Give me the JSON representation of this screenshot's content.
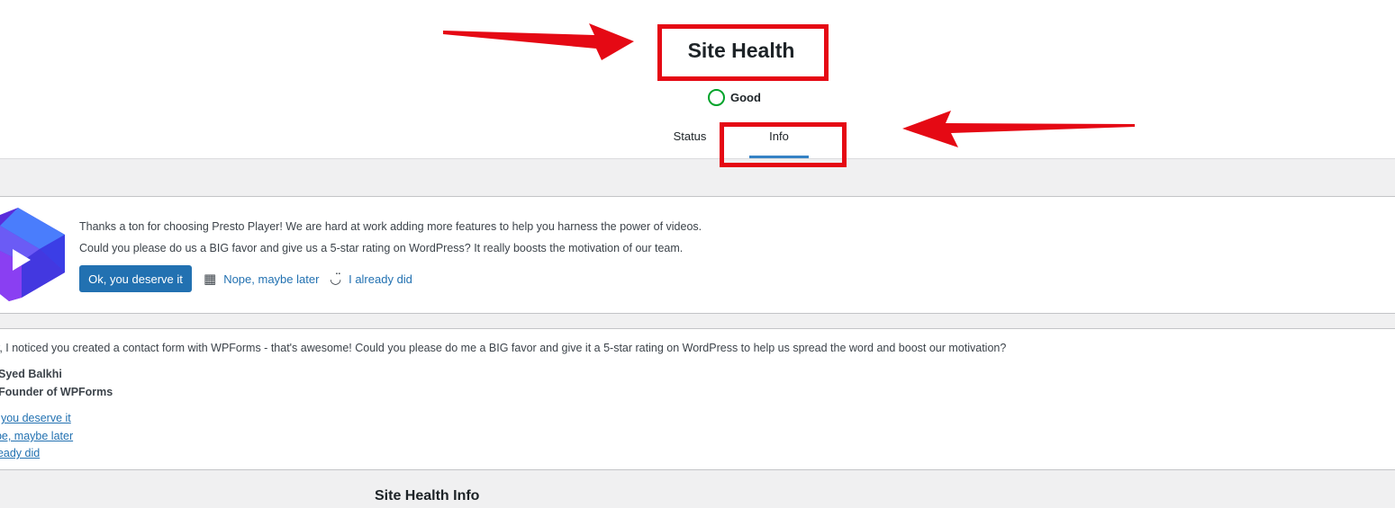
{
  "header": {
    "title": "Site Health",
    "status": "Good",
    "tabs": [
      {
        "label": "Status"
      },
      {
        "label": "Info"
      }
    ]
  },
  "presto_notice": {
    "line1": "Thanks a ton for choosing Presto Player! We are hard at work adding more features to help you harness the power of videos.",
    "line2": "Could you please do us a BIG favor and give us a 5-star rating on WordPress? It really boosts the motivation of our team.",
    "primary_button": "Ok, you deserve it",
    "later_link": "Nope, maybe later",
    "did_link": "I already did"
  },
  "wpforms_notice": {
    "text": "y, I noticed you created a contact form with WPForms - that's awesome! Could you please do me a BIG favor and give it a 5-star rating on WordPress to help us spread the word and boost our motivation?",
    "signature_name": "Syed Balkhi",
    "signature_role": "-Founder of WPForms",
    "links": [
      ", you deserve it",
      "ope, maybe later",
      "lready did"
    ]
  },
  "section": {
    "title": "Site Health Info"
  },
  "colors": {
    "accent": "#2271b1",
    "tab_indicator": "#3582c4",
    "status_good": "#00a32a",
    "annotation_red": "#e50914"
  }
}
